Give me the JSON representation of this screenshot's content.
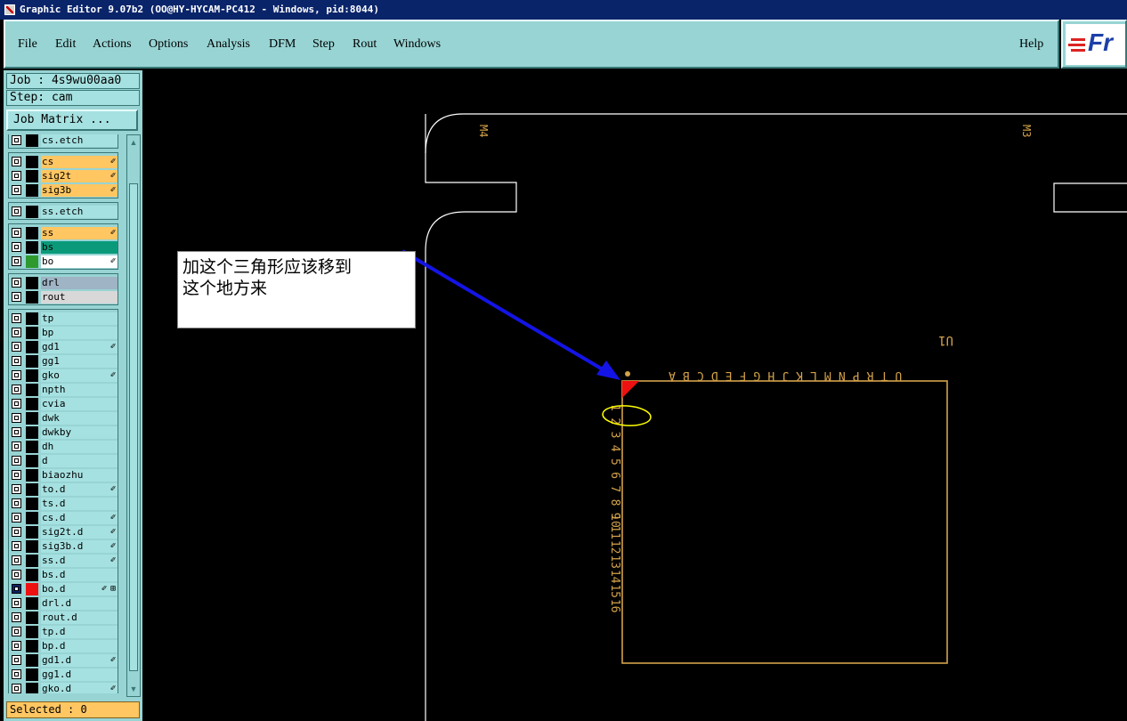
{
  "window": {
    "title": "Graphic Editor 9.07b2 (OO@HY-HYCAM-PC412 - Windows, pid:8044)"
  },
  "menu": {
    "items": [
      "File",
      "Edit",
      "Actions",
      "Options",
      "Analysis",
      "DFM",
      "Step",
      "Rout",
      "Windows"
    ],
    "help": "Help"
  },
  "logo": {
    "text": "Fr"
  },
  "panel": {
    "job": "Job : 4s9wu00aa0",
    "step": "Step: cam",
    "matrix_button": "Job Matrix ...",
    "selected": "Selected : 0"
  },
  "layers": [
    {
      "name": "cs.etch",
      "bg": "#a6e1e1",
      "ind": "#000000",
      "flag": ""
    },
    {
      "name": "cs",
      "bg": "#ffc662",
      "ind": "#000000",
      "flag": "✐"
    },
    {
      "name": "sig2t",
      "bg": "#ffc662",
      "ind": "#000000",
      "flag": "✐"
    },
    {
      "name": "sig3b",
      "bg": "#ffc662",
      "ind": "#000000",
      "flag": "✐"
    },
    {
      "name": "ss.etch",
      "bg": "#a6e1e1",
      "ind": "#000000",
      "flag": ""
    },
    {
      "name": "ss",
      "bg": "#ffc662",
      "ind": "#000000",
      "flag": "✐"
    },
    {
      "name": "bs",
      "bg": "#0a9a7a",
      "ind": "#000000",
      "flag": ""
    },
    {
      "name": "bo",
      "bg": "#ffffff",
      "ind": "#2e9a2e",
      "flag": "✐"
    },
    {
      "name": "drl",
      "bg": "#9fb4c4",
      "ind": "#000000",
      "flag": ""
    },
    {
      "name": "rout",
      "bg": "#d8d8d8",
      "ind": "#000000",
      "flag": ""
    },
    {
      "name": "tp",
      "bg": "#a6e1e1",
      "ind": "#000000",
      "flag": ""
    },
    {
      "name": "bp",
      "bg": "#a6e1e1",
      "ind": "#000000",
      "flag": ""
    },
    {
      "name": "gd1",
      "bg": "#a6e1e1",
      "ind": "#000000",
      "flag": "✐"
    },
    {
      "name": "gg1",
      "bg": "#a6e1e1",
      "ind": "#000000",
      "flag": ""
    },
    {
      "name": "gko",
      "bg": "#a6e1e1",
      "ind": "#000000",
      "flag": "✐"
    },
    {
      "name": "npth",
      "bg": "#a6e1e1",
      "ind": "#000000",
      "flag": ""
    },
    {
      "name": "cvia",
      "bg": "#a6e1e1",
      "ind": "#000000",
      "flag": ""
    },
    {
      "name": "dwk",
      "bg": "#a6e1e1",
      "ind": "#000000",
      "flag": ""
    },
    {
      "name": "dwkby",
      "bg": "#a6e1e1",
      "ind": "#000000",
      "flag": ""
    },
    {
      "name": "dh",
      "bg": "#a6e1e1",
      "ind": "#000000",
      "flag": ""
    },
    {
      "name": "d",
      "bg": "#a6e1e1",
      "ind": "#000000",
      "flag": ""
    },
    {
      "name": "biaozhu",
      "bg": "#a6e1e1",
      "ind": "#000000",
      "flag": ""
    },
    {
      "name": "to.d",
      "bg": "#a6e1e1",
      "ind": "#000000",
      "flag": "✐"
    },
    {
      "name": "ts.d",
      "bg": "#a6e1e1",
      "ind": "#000000",
      "flag": ""
    },
    {
      "name": "cs.d",
      "bg": "#a6e1e1",
      "ind": "#000000",
      "flag": "✐"
    },
    {
      "name": "sig2t.d",
      "bg": "#a6e1e1",
      "ind": "#000000",
      "flag": "✐"
    },
    {
      "name": "sig3b.d",
      "bg": "#a6e1e1",
      "ind": "#000000",
      "flag": "✐"
    },
    {
      "name": "ss.d",
      "bg": "#a6e1e1",
      "ind": "#000000",
      "flag": "✐"
    },
    {
      "name": "bs.d",
      "bg": "#a6e1e1",
      "ind": "#000000",
      "flag": ""
    },
    {
      "name": "bo.d",
      "bg": "#a6e1e1",
      "ind": "#ee1111",
      "flag": "✐",
      "work": true
    },
    {
      "name": "drl.d",
      "bg": "#a6e1e1",
      "ind": "#000000",
      "flag": ""
    },
    {
      "name": "rout.d",
      "bg": "#a6e1e1",
      "ind": "#000000",
      "flag": ""
    },
    {
      "name": "tp.d",
      "bg": "#a6e1e1",
      "ind": "#000000",
      "flag": ""
    },
    {
      "name": "bp.d",
      "bg": "#a6e1e1",
      "ind": "#000000",
      "flag": ""
    },
    {
      "name": "gd1.d",
      "bg": "#a6e1e1",
      "ind": "#000000",
      "flag": "✐"
    },
    {
      "name": "gg1.d",
      "bg": "#a6e1e1",
      "ind": "#000000",
      "flag": ""
    },
    {
      "name": "gko.d",
      "bg": "#a6e1e1",
      "ind": "#000000",
      "flag": "✐"
    }
  ],
  "board": {
    "label_tl": "M4",
    "label_tr": "M3",
    "label_ref": "U1",
    "top_pins": [
      "A",
      "B",
      "C",
      "D",
      "E",
      "F",
      "G",
      "H",
      "J",
      "K",
      "L",
      "M",
      "N",
      "P",
      "R",
      "T",
      "U"
    ],
    "left_pins": [
      "1",
      "2",
      "3",
      "4",
      "5",
      "6",
      "7",
      "8",
      "9",
      "10",
      "11",
      "12",
      "13",
      "14",
      "15",
      "16"
    ],
    "color_outline": "#ffffff",
    "color_silk": "#d4a24a",
    "color_marker": "#ee1111",
    "color_annotation": "#ffff00",
    "color_arrow": "#1414e6"
  },
  "callout": {
    "line1": "加这个三角形应该移到",
    "line2": "这个地方来"
  }
}
